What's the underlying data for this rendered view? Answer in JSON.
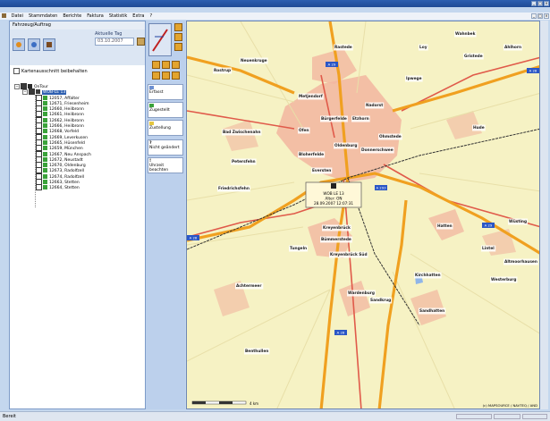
{
  "menu": [
    "Datei",
    "Stammdaten",
    "Berichte",
    "Faktura",
    "Statistik",
    "Extra",
    "?"
  ],
  "left_panel": {
    "tab_title": "Fahrzeug/Auftrag",
    "day_label": "Aktuelle Tag",
    "day_value": "03.10.2007",
    "checkbox_label": "Kartenausschnitt beibehalten",
    "tree": {
      "root_label": "OnTour",
      "vehicle_label": "WOB-LE 13",
      "items": [
        "12057, Affalter",
        "12671, Friesenheim",
        "12660, Heilbronn",
        "12661, Heilbronn",
        "12662, Heilbronn",
        "12666, Heilbronn",
        "12668, Vorfeld",
        "12669, Leverkusen",
        "12665, Hüsenfeld",
        "12659, München",
        "12667, Neu Anspach",
        "12672, Neustadt",
        "12670, Oldenburg",
        "12673, Radolfzell",
        "12674, Radolfzell",
        "12663, Stetten",
        "12664, Stetten"
      ]
    }
  },
  "side_buttons": [
    {
      "label": "Erfasst",
      "color": "#6c8fd1"
    },
    {
      "label": "Zugestellt",
      "color": "#3aa23a"
    },
    {
      "label": "Zustellung",
      "color": "#e4c640"
    },
    {
      "label": "Nicht geändert",
      "icon": "?"
    },
    {
      "label": "Uhrzeit beachten",
      "icon": "!"
    }
  ],
  "map": {
    "popup": {
      "title": "WOB LE 13",
      "line2": "Alter: ON",
      "line3": "28.09.2007 12:07:31"
    },
    "attribution": "(c) MAPSOURCE / NAVTEQ / AND",
    "scale": "4 km",
    "cities": [
      {
        "name": "Oldenburg"
      },
      {
        "name": "Bad Zwischenahn"
      },
      {
        "name": "Hude"
      },
      {
        "name": "Wardenburg"
      },
      {
        "name": "Hatten"
      },
      {
        "name": "Rastede"
      },
      {
        "name": "Metjendorf"
      },
      {
        "name": "Ofen"
      },
      {
        "name": "Bümmerstede"
      },
      {
        "name": "Kreyenbrück"
      },
      {
        "name": "Tungeln"
      },
      {
        "name": "Sandkrug"
      },
      {
        "name": "Rostrup"
      },
      {
        "name": "Etzhorn"
      },
      {
        "name": "Ohmstede"
      },
      {
        "name": "Bloherfelde"
      },
      {
        "name": "Eversten"
      },
      {
        "name": "Donnerschwee"
      },
      {
        "name": "Kreyenbrück Süd"
      },
      {
        "name": "Ahlhorn"
      },
      {
        "name": "Achtermeer"
      },
      {
        "name": "Benthullen"
      },
      {
        "name": "Westerburg"
      },
      {
        "name": "Sandhatten"
      },
      {
        "name": "Wüsting"
      },
      {
        "name": "Neuenkruge"
      },
      {
        "name": "Gristede"
      },
      {
        "name": "Petersfehn"
      },
      {
        "name": "Friedrichsfehn"
      },
      {
        "name": "Bürgerfelde"
      },
      {
        "name": "Ipwege"
      },
      {
        "name": "Nadorst"
      },
      {
        "name": "Kirchhatten"
      },
      {
        "name": "Altmoorhausen"
      },
      {
        "name": "Lintel"
      },
      {
        "name": "Wahnbek"
      },
      {
        "name": "Loy"
      }
    ],
    "motorway_labels": [
      "A 28",
      "A 29",
      "A 293",
      "A 28",
      "A 29",
      "A 28"
    ]
  },
  "status": {
    "text": "Bereit"
  },
  "colors": {
    "desktop": "#3a78c0",
    "panel": "#dce6f3",
    "map_bg": "#f6f2c4",
    "city": "#f2b6a0",
    "motorway": "#f0a020",
    "road": "#e05a4a"
  }
}
